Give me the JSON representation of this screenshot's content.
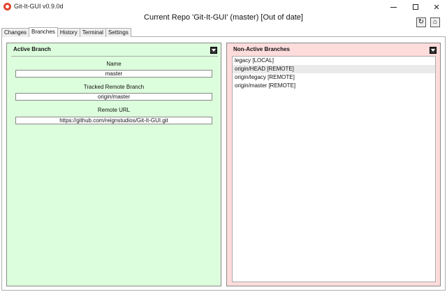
{
  "window": {
    "title": "Git-It-GUI v0.9.0d",
    "min_icon": "minimize-icon",
    "max_icon": "maximize-icon",
    "close_glyph": "✕"
  },
  "header": {
    "repo_title": "Current Repo 'Git-It-GUI' (master) [Out of date]",
    "refresh_glyph": "↻",
    "home_glyph": "⌂"
  },
  "tabs": [
    {
      "label": "Changes"
    },
    {
      "label": "Branches"
    },
    {
      "label": "History"
    },
    {
      "label": "Terminal"
    },
    {
      "label": "Settings"
    }
  ],
  "active_panel": {
    "header": "Active Branch",
    "name_label": "Name",
    "name_value": "master",
    "tracked_label": "Tracked Remote Branch",
    "tracked_value": "origin/master",
    "url_label": "Remote URL",
    "url_value": "https://github.com/reignstudios/Git-It-GUI.git",
    "color": "#dcfedc"
  },
  "inactive_panel": {
    "header": "Non-Active Branches",
    "color": "#ffdcdc",
    "items": [
      {
        "label": "legacy [LOCAL]"
      },
      {
        "label": "origin/HEAD [REMOTE]"
      },
      {
        "label": "origin/legacy [REMOTE]"
      },
      {
        "label": "origin/master [REMOTE]"
      }
    ]
  }
}
